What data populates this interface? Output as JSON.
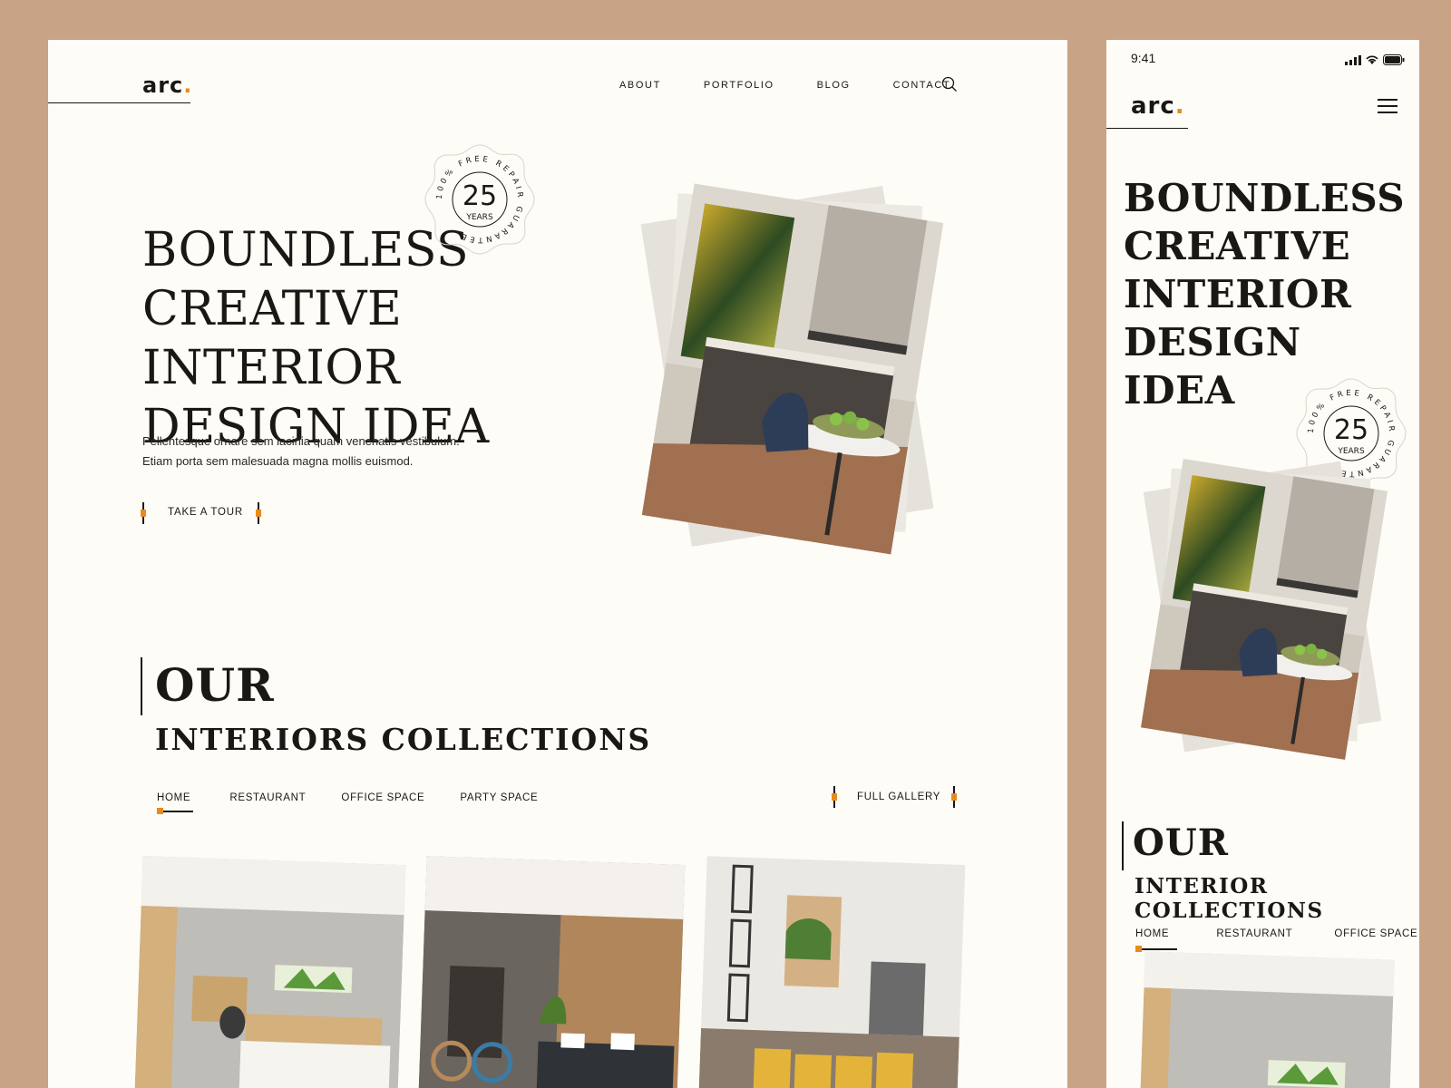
{
  "brand": {
    "logo": "arc",
    "logo_dot": ".",
    "accent_color": "#e98a1e",
    "background": "#c8a385"
  },
  "nav": {
    "items": [
      "ABOUT",
      "PORTFOLIO",
      "BLOG",
      "CONTACT"
    ]
  },
  "hero": {
    "title_lines": [
      "BOUNDLESS",
      "CREATIVE INTERIOR",
      "DESIGN IDEA"
    ],
    "description_lines": [
      "Pellentesque ornare sem lacinia quam venenatis vestibulum.",
      "Etiam porta sem malesuada magna mollis euismod."
    ],
    "cta": "TAKE A TOUR"
  },
  "badge": {
    "number": "25",
    "unit": "YEARS",
    "ring_text": "100% FREE REPAIR GUARANTEE."
  },
  "collections": {
    "title_top": "OUR",
    "title_bottom": "INTERIORS COLLECTIONS",
    "tabs": [
      "HOME",
      "RESTAURANT",
      "OFFICE SPACE",
      "PARTY SPACE"
    ],
    "gallery_link": "FULL GALLERY"
  },
  "mobile": {
    "status_time": "9:41",
    "title_lines": [
      "BOUNDLESS",
      "CREATIVE",
      "INTERIOR",
      "DESIGN IDEA"
    ],
    "collections_top": "OUR",
    "collections_bottom": "INTERIOR COLLECTIONS",
    "tabs": [
      "HOME",
      "RESTAURANT",
      "OFFICE SPACE"
    ]
  }
}
